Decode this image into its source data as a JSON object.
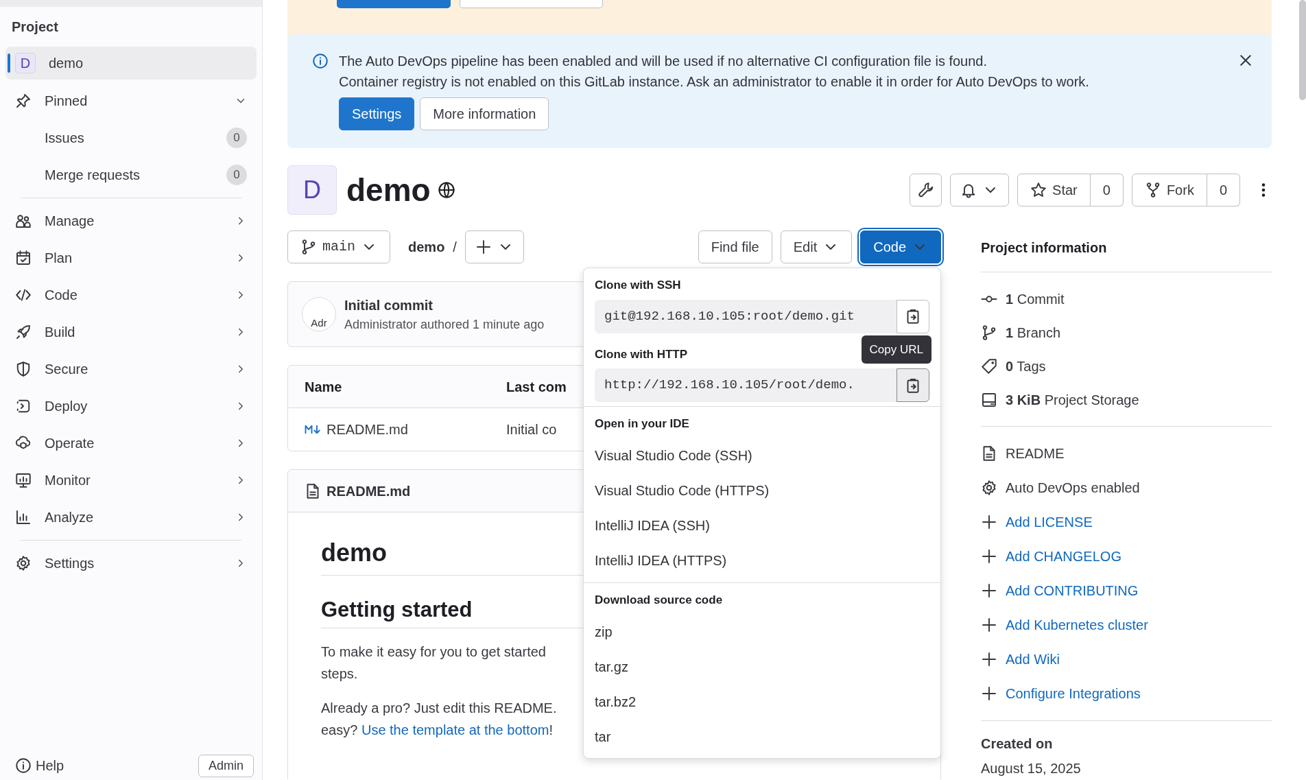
{
  "sidebar": {
    "title": "Project",
    "project": {
      "avatar": "D",
      "name": "demo",
      "selected": true
    },
    "pinned": {
      "label": "Pinned",
      "expanded": true,
      "items": [
        {
          "label": "Issues",
          "count": "0"
        },
        {
          "label": "Merge requests",
          "count": "0"
        }
      ]
    },
    "items": [
      {
        "label": "Manage"
      },
      {
        "label": "Plan"
      },
      {
        "label": "Code"
      },
      {
        "label": "Build"
      },
      {
        "label": "Secure"
      },
      {
        "label": "Deploy"
      },
      {
        "label": "Operate"
      },
      {
        "label": "Monitor"
      },
      {
        "label": "Analyze"
      }
    ],
    "settings": {
      "label": "Settings"
    },
    "footer": {
      "help": "Help",
      "admin": "Admin"
    }
  },
  "alert": {
    "lines": [
      "The Auto DevOps pipeline has been enabled and will be used if no alternative CI configuration file is found.",
      "Container registry is not enabled on this GitLab instance. Ask an administrator to enable it in order for Auto DevOps to work."
    ],
    "buttons": [
      {
        "label": "Settings",
        "kind": "primary"
      },
      {
        "label": "More information",
        "kind": "default"
      }
    ]
  },
  "project": {
    "avatar": "D",
    "name": "demo",
    "star": {
      "label": "Star",
      "count": "0"
    },
    "fork": {
      "label": "Fork",
      "count": "0"
    }
  },
  "toolbar": {
    "branch": "main",
    "path": "demo",
    "separator": "/",
    "buttons": [
      {
        "label": "Find file",
        "kind": "plain"
      },
      {
        "label": "Edit",
        "kind": "dropdown"
      },
      {
        "label": "Code",
        "kind": "primary",
        "open": true
      }
    ]
  },
  "code_menu": {
    "clone": [
      {
        "label": "Clone with SSH",
        "url": "git@192.168.10.105:root/demo.git"
      },
      {
        "label": "Clone with HTTP",
        "url": "http://192.168.10.105/root/demo.",
        "tooltip": "Copy URL"
      }
    ],
    "sections": [
      {
        "label": "Open in your IDE",
        "items": [
          "Visual Studio Code (SSH)",
          "Visual Studio Code (HTTPS)",
          "IntelliJ IDEA (SSH)",
          "IntelliJ IDEA (HTTPS)"
        ]
      },
      {
        "label": "Download source code",
        "items": [
          "zip",
          "tar.gz",
          "tar.bz2",
          "tar"
        ]
      }
    ]
  },
  "commit": {
    "avatar_alt": "Adr",
    "title": "Initial commit",
    "author": "Administrator",
    "meta": "authored 1 minute ago"
  },
  "table": {
    "columns": [
      "Name",
      "Last com"
    ],
    "rows": [
      {
        "name": "README.md",
        "last_commit": "Initial co"
      }
    ]
  },
  "readme": {
    "title": "README.md",
    "h1": "demo",
    "h2": "Getting started",
    "paragraph_1": [
      "To make it easy for you to get started",
      "steps."
    ],
    "paragraph_2": {
      "line_1": "Already a pro? Just edit this README.",
      "before": "easy? ",
      "link": "Use the template at the bottom",
      "after": "!"
    }
  },
  "project_info": {
    "title": "Project information",
    "stats": [
      {
        "value": "1",
        "label": "Commit"
      },
      {
        "value": "1",
        "label": "Branch"
      },
      {
        "value": "0",
        "label": "Tags"
      },
      {
        "value": "3 KiB",
        "label": "Project Storage"
      }
    ],
    "links": [
      {
        "label": "README",
        "kind": "file"
      },
      {
        "label": "Auto DevOps enabled",
        "kind": "gear"
      },
      {
        "label": "Add LICENSE",
        "kind": "add"
      },
      {
        "label": "Add CHANGELOG",
        "kind": "add"
      },
      {
        "label": "Add CONTRIBUTING",
        "kind": "add"
      },
      {
        "label": "Add Kubernetes cluster",
        "kind": "add"
      },
      {
        "label": "Add Wiki",
        "kind": "add"
      },
      {
        "label": "Configure Integrations",
        "kind": "add"
      }
    ],
    "created_label": "Created on",
    "created_date": "August 15, 2025"
  }
}
